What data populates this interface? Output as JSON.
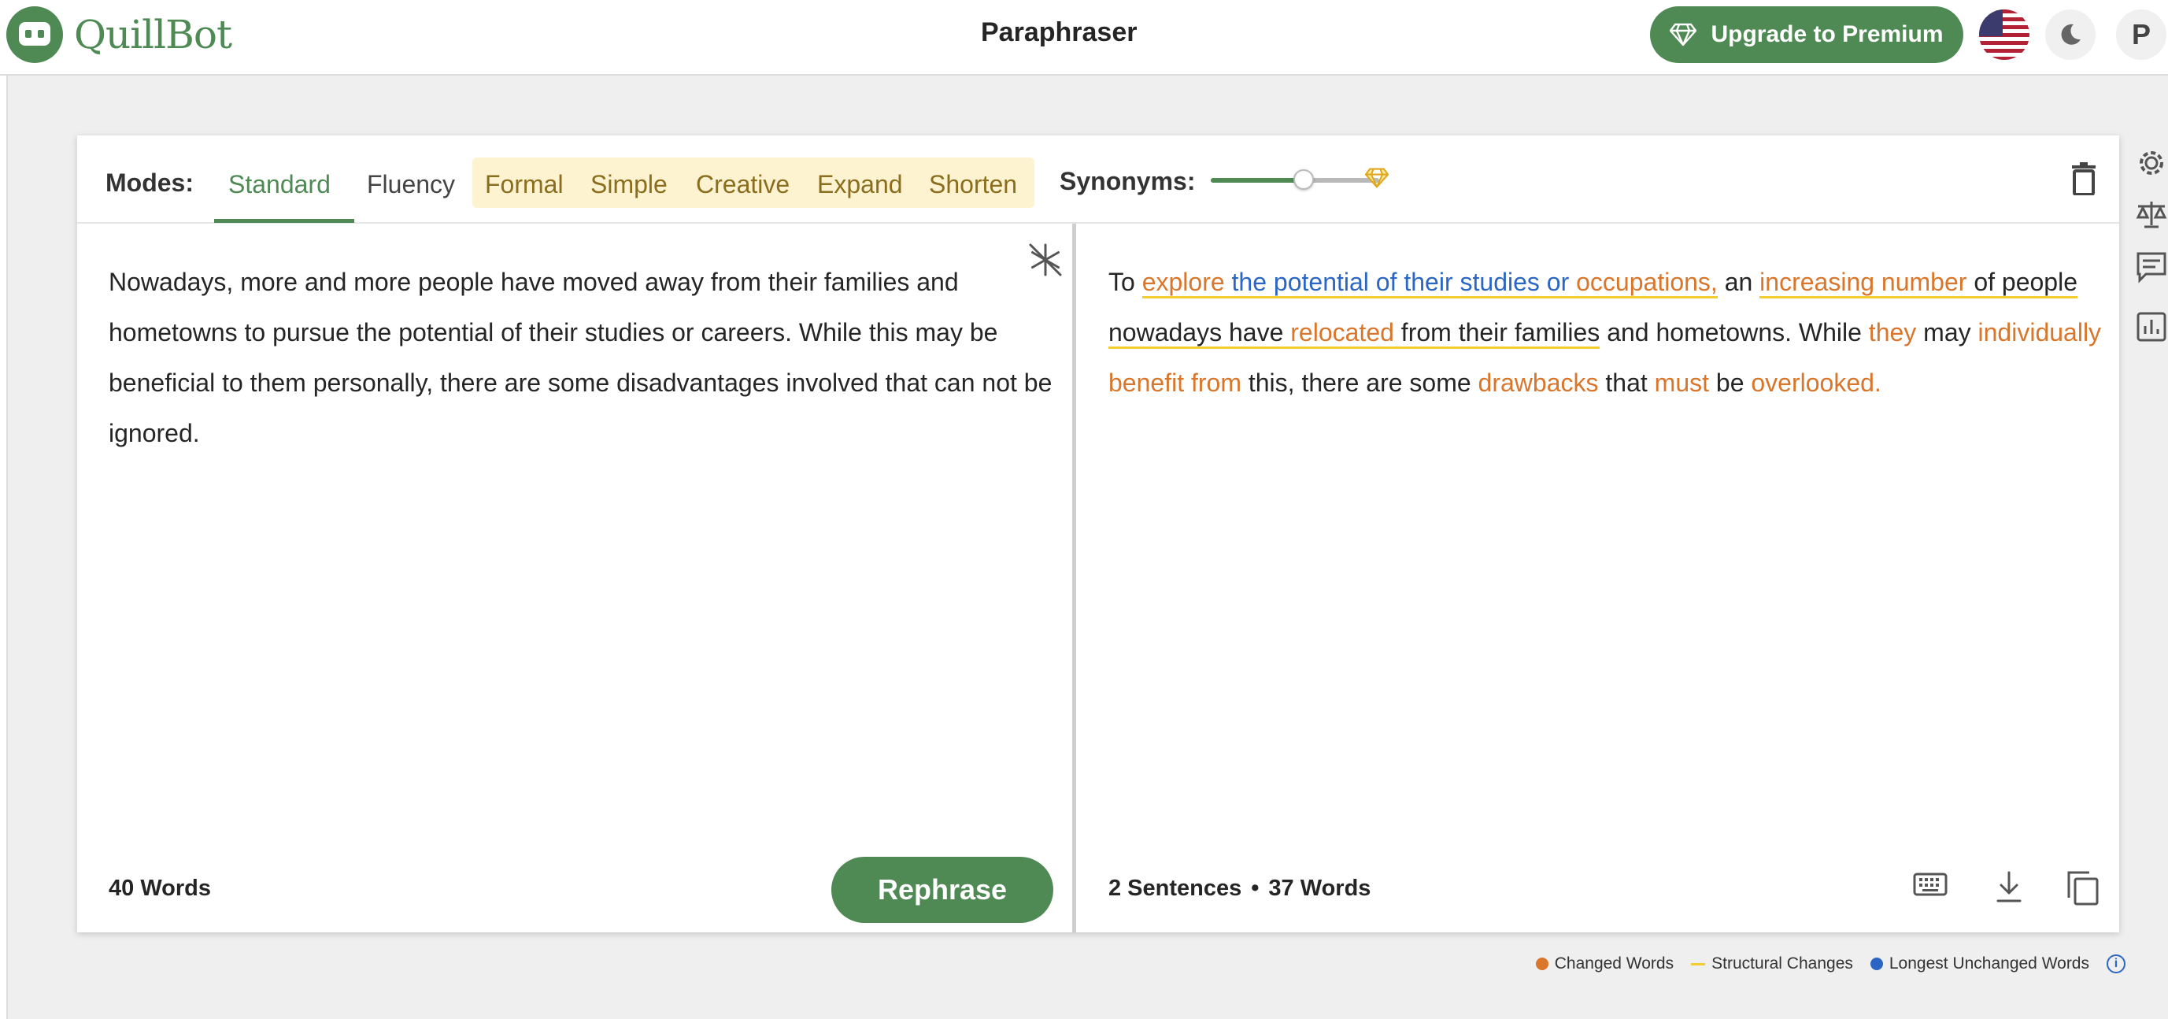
{
  "header": {
    "logo_text": "QuillBot",
    "title": "Paraphraser",
    "upgrade_label": "Upgrade to Premium",
    "avatar_initial": "P"
  },
  "modes": {
    "label": "Modes:",
    "items": [
      "Standard",
      "Fluency",
      "Formal",
      "Simple",
      "Creative",
      "Expand",
      "Shorten"
    ],
    "active": "Standard",
    "premium": [
      "Formal",
      "Simple",
      "Creative",
      "Expand",
      "Shorten"
    ]
  },
  "synonyms": {
    "label": "Synonyms:",
    "level": 0.55
  },
  "input": {
    "text": "Nowadays, more and more people have moved away from their families and hometowns to pursue the potential of their studies or careers. While this may be beneficial to them personally, there are some disadvantages involved that can not be ignored.",
    "word_count": "40 Words",
    "rephrase_label": "Rephrase"
  },
  "output": {
    "segments": [
      {
        "text": "To ",
        "type": "plain"
      },
      {
        "text": "explore",
        "type": "changed",
        "structural": true
      },
      {
        "text": " ",
        "type": "plain",
        "structural": true
      },
      {
        "text": "the potential of their studies or ",
        "type": "longest",
        "structural": true
      },
      {
        "text": "occupations,",
        "type": "changed",
        "structural": true
      },
      {
        "text": " an ",
        "type": "plain"
      },
      {
        "text": "increasing number",
        "type": "changed",
        "structural": true
      },
      {
        "text": " of people nowadays have ",
        "type": "plain",
        "structural": true
      },
      {
        "text": "relocated",
        "type": "changed",
        "structural": true
      },
      {
        "text": " from their families",
        "type": "plain",
        "structural": true
      },
      {
        "text": " and hometowns. While ",
        "type": "plain"
      },
      {
        "text": "they",
        "type": "changed"
      },
      {
        "text": " may ",
        "type": "plain"
      },
      {
        "text": "individually benefit from",
        "type": "changed"
      },
      {
        "text": " this, there are some ",
        "type": "plain"
      },
      {
        "text": "drawbacks",
        "type": "changed"
      },
      {
        "text": " that ",
        "type": "plain"
      },
      {
        "text": "must",
        "type": "changed"
      },
      {
        "text": " be ",
        "type": "plain"
      },
      {
        "text": "overlooked.",
        "type": "changed"
      }
    ],
    "sentences": "2 Sentences",
    "separator": "•",
    "word_count": "37 Words"
  },
  "legend": {
    "changed": "Changed Words",
    "structural": "Structural Changes",
    "longest": "Longest Unchanged Words",
    "info": "i"
  },
  "colors": {
    "brand": "#4f8a55",
    "changed": "#d9762b",
    "structural": "#f3cc2f",
    "longest": "#2b66c4",
    "premium_bg": "#fdf3d1"
  },
  "icons": {
    "logo": "quillbot-robot-icon",
    "upgrade": "diamond-icon",
    "flag": "us-flag-icon",
    "theme": "moon-icon",
    "delete": "trash-icon",
    "freeze": "snowflake-icon",
    "keyboard": "keyboard-icon",
    "download": "download-icon",
    "copy": "copy-icon",
    "rail": [
      "settings-icon",
      "compare-icon",
      "comments-icon",
      "statistics-icon"
    ]
  }
}
